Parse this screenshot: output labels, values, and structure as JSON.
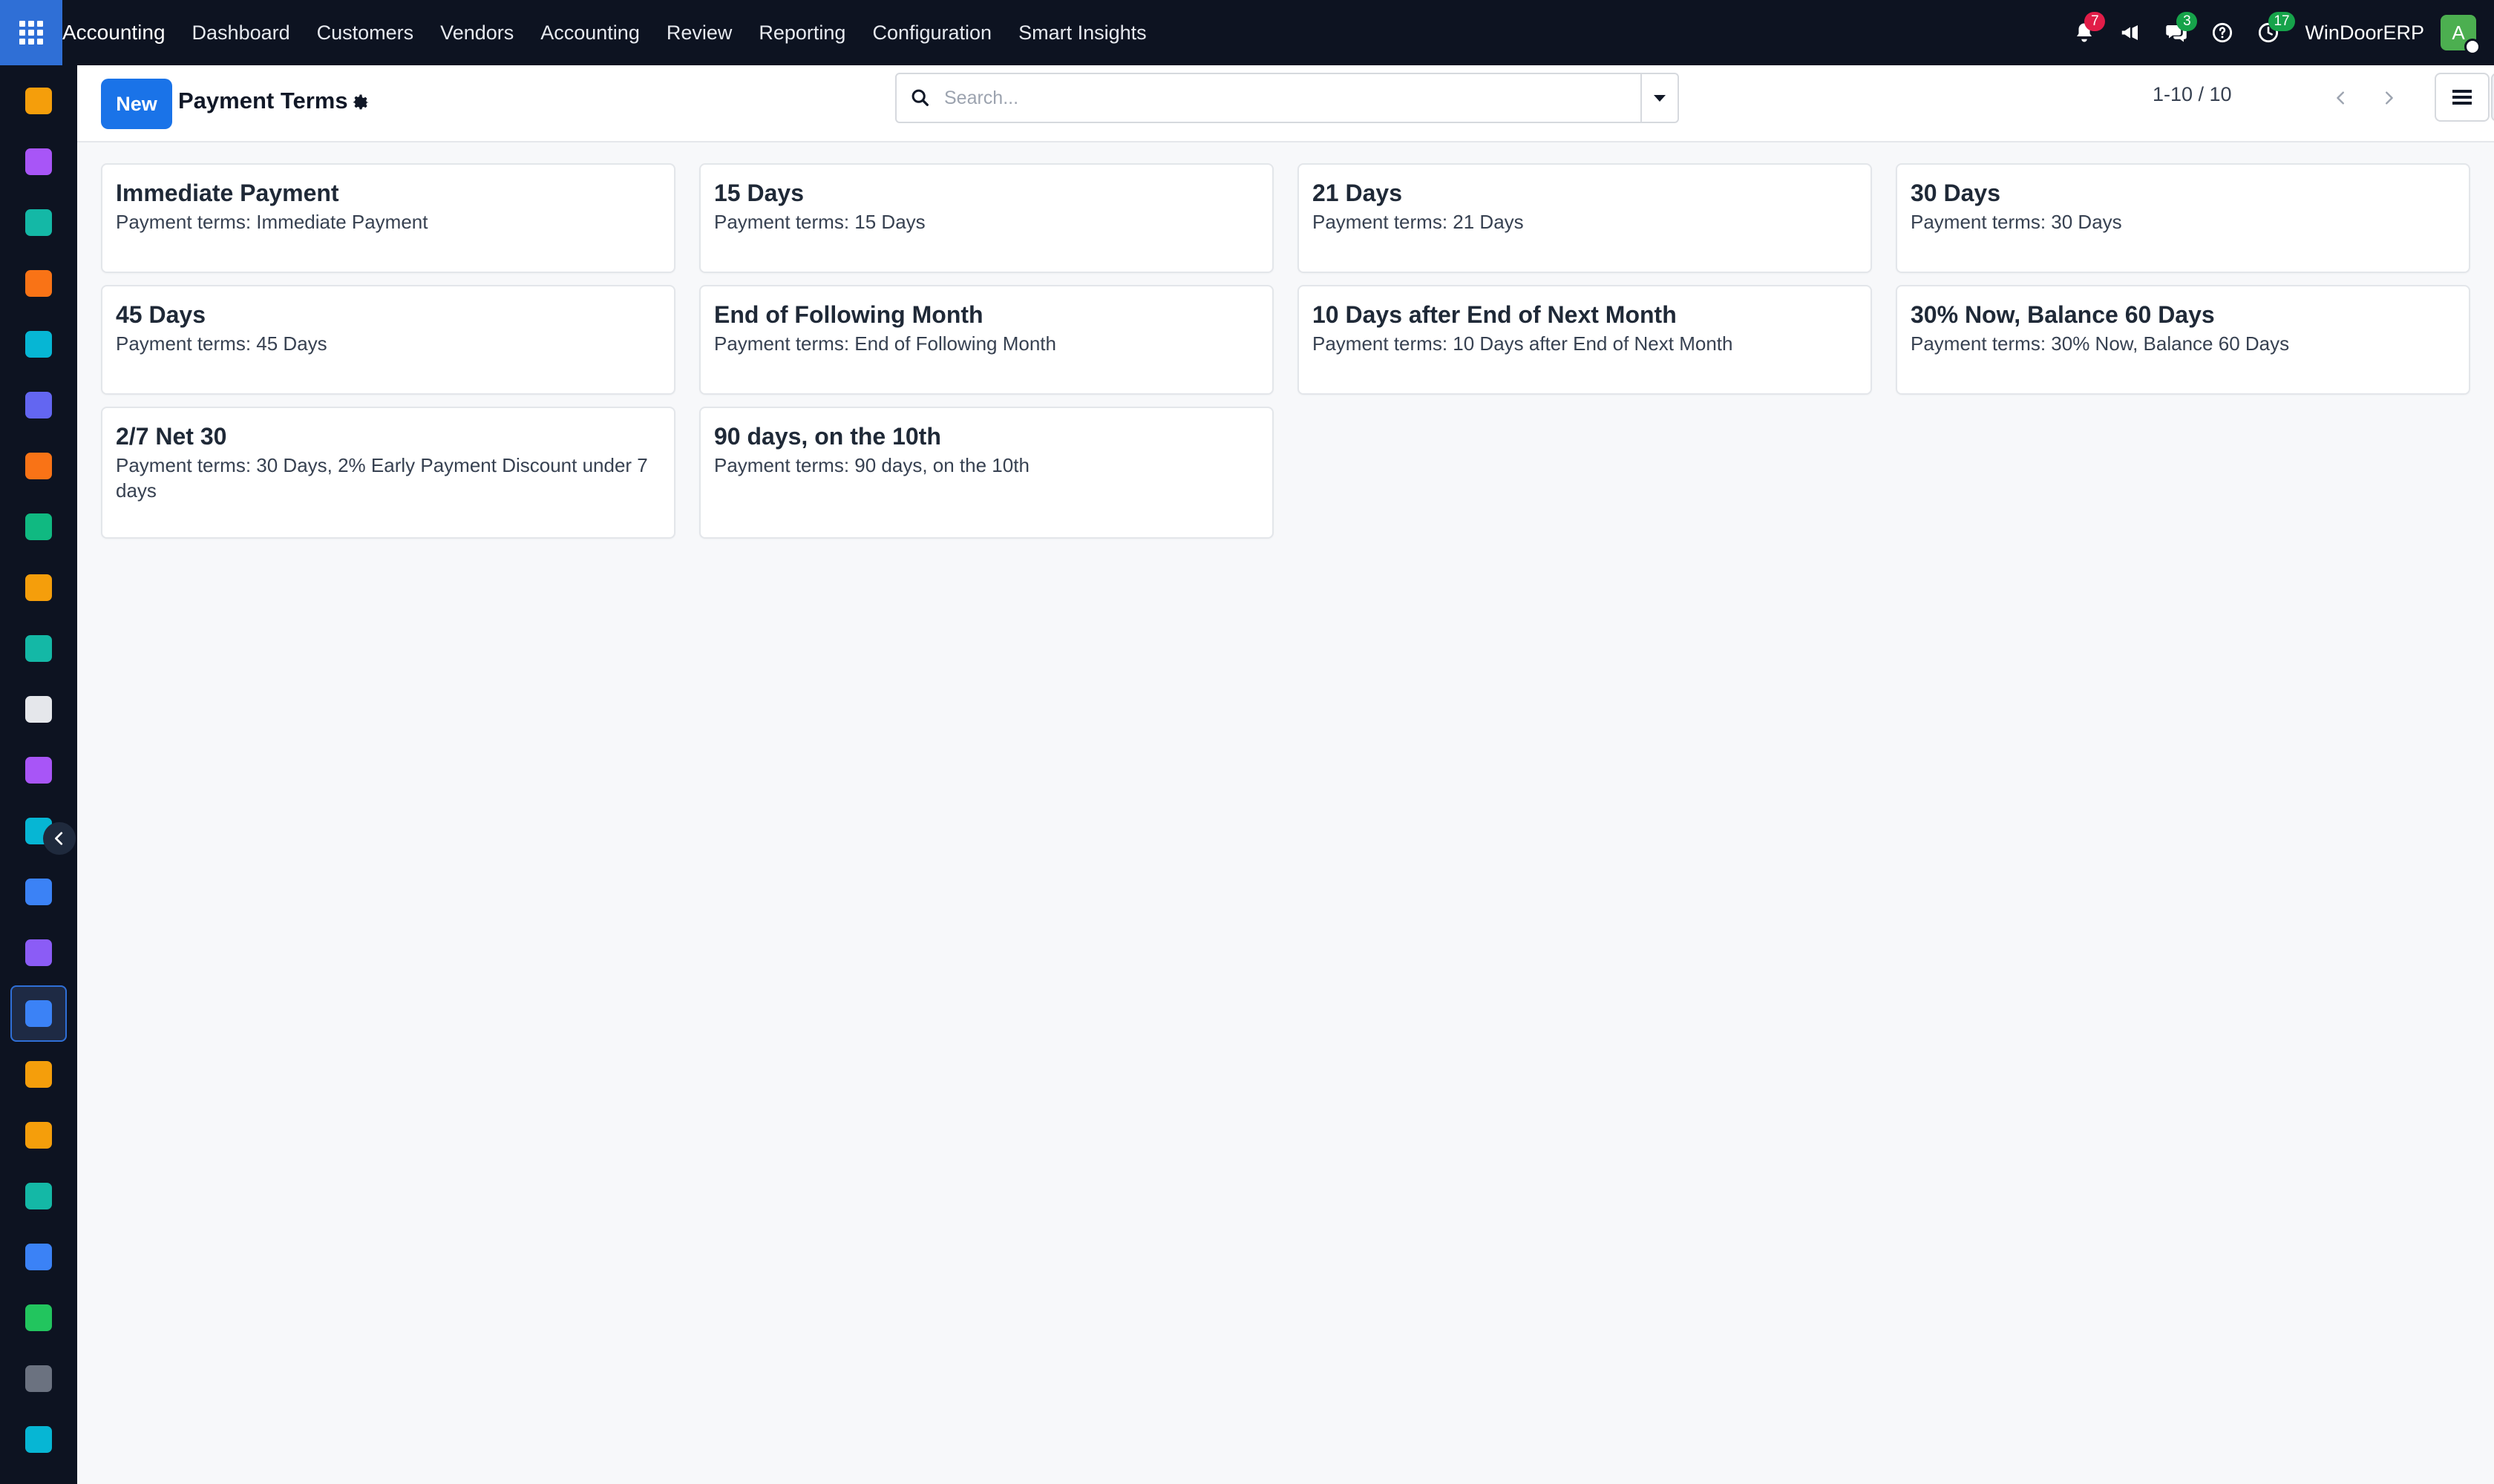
{
  "navbar": {
    "app_name": "Accounting",
    "menu": [
      "Dashboard",
      "Customers",
      "Vendors",
      "Accounting",
      "Review",
      "Reporting",
      "Configuration",
      "Smart Insights"
    ],
    "notifications_count": "7",
    "messages_count": "3",
    "activities_count": "17",
    "company": "WinDoorERP",
    "avatar_initial": "A"
  },
  "control_panel": {
    "new_label": "New",
    "title": "Payment Terms",
    "search_placeholder": "Search...",
    "pager": "1-10 / 10"
  },
  "cards": [
    {
      "title": "Immediate Payment",
      "subtitle": "Payment terms: Immediate Payment"
    },
    {
      "title": "15 Days",
      "subtitle": "Payment terms: 15 Days"
    },
    {
      "title": "21 Days",
      "subtitle": "Payment terms: 21 Days"
    },
    {
      "title": "30 Days",
      "subtitle": "Payment terms: 30 Days"
    },
    {
      "title": "45 Days",
      "subtitle": "Payment terms: 45 Days"
    },
    {
      "title": "End of Following Month",
      "subtitle": "Payment terms: End of Following Month"
    },
    {
      "title": "10 Days after End of Next Month",
      "subtitle": "Payment terms: 10 Days after End of Next Month"
    },
    {
      "title": "30% Now, Balance 60 Days",
      "subtitle": "Payment terms: 30% Now, Balance 60 Days"
    },
    {
      "title": "2/7 Net 30",
      "subtitle": "Payment terms: 30 Days, 2% Early Payment Discount under 7 days"
    },
    {
      "title": "90 days, on the 10th",
      "subtitle": "Payment terms: 90 days, on the 10th"
    }
  ],
  "sidebar_apps": [
    {
      "icon": "sales-chart-icon",
      "color": "#f59e0b"
    },
    {
      "icon": "inventory-icon",
      "color": "#a855f7"
    },
    {
      "icon": "contacts-icon",
      "color": "#14b8a6"
    },
    {
      "icon": "discuss-icon",
      "color": "#f97316"
    },
    {
      "icon": "website-icon",
      "color": "#06b6d4"
    },
    {
      "icon": "email-marketing-icon",
      "color": "#6366f1"
    },
    {
      "icon": "live-chat-icon",
      "color": "#f97316"
    },
    {
      "icon": "project-icon",
      "color": "#10b981"
    },
    {
      "icon": "crm-chart-icon",
      "color": "#f59e0b"
    },
    {
      "icon": "employees-icon",
      "color": "#14b8a6"
    },
    {
      "icon": "product-cube-icon",
      "color": "#e5e7eb"
    },
    {
      "icon": "purchase-icon",
      "color": "#a855f7"
    },
    {
      "icon": "todo-check-icon",
      "color": "#06b6d4"
    },
    {
      "icon": "knowledge-icon",
      "color": "#3b82f6"
    },
    {
      "icon": "stock-box-icon",
      "color": "#8b5cf6"
    },
    {
      "icon": "invoicing-icon",
      "color": "#3b82f6"
    },
    {
      "icon": "team-icon",
      "color": "#f59e0b"
    },
    {
      "icon": "calendar-icon",
      "color": "#f59e0b"
    },
    {
      "icon": "sign-icon",
      "color": "#14b8a6"
    },
    {
      "icon": "dashboards-icon",
      "color": "#3b82f6"
    },
    {
      "icon": "whatsapp-icon",
      "color": "#22c55e"
    },
    {
      "icon": "timer-icon",
      "color": "#6b7280"
    },
    {
      "icon": "website-wave-icon",
      "color": "#06b6d4"
    }
  ]
}
